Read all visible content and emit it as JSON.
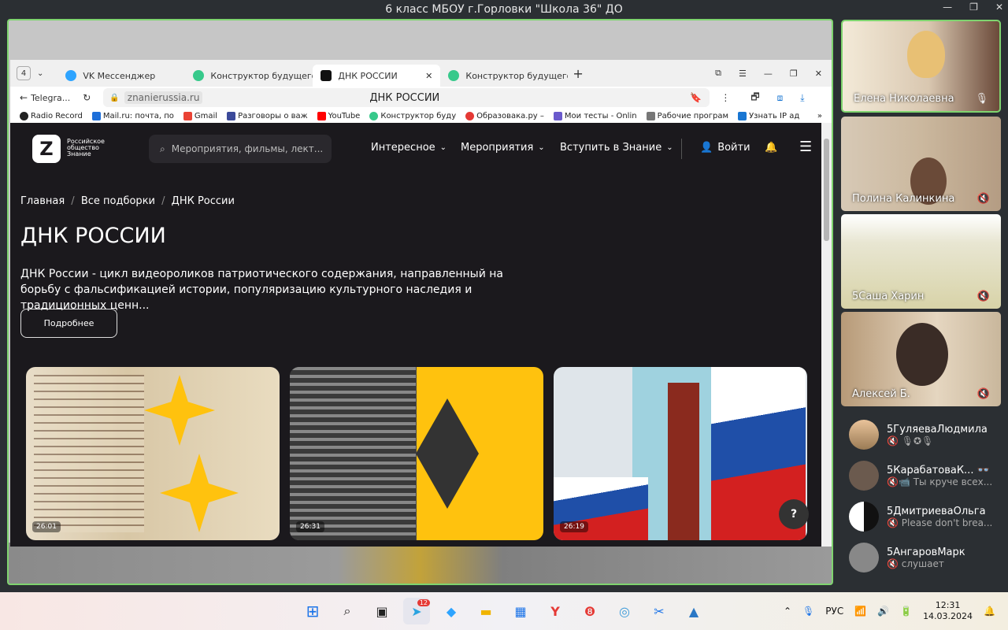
{
  "window": {
    "title": "6 класс МБОУ г.Горловки \"Школа 36\" ДО"
  },
  "browser": {
    "tab_count": "4",
    "tabs": [
      {
        "label": "VK Мессенджер",
        "color": "#2ea4ff"
      },
      {
        "label": "Конструктор будущего",
        "color": "#37c98b"
      },
      {
        "label": "ДНК РОССИИ",
        "color": "#111111"
      },
      {
        "label": "Конструктор будущего",
        "color": "#37c98b"
      }
    ],
    "back_label": "Telegra...",
    "url": "znanierussia.ru",
    "page_title": "ДНК РОССИИ",
    "bookmarks": [
      {
        "label": "Radio Record",
        "color": "#222222"
      },
      {
        "label": "Mail.ru: почта, по",
        "color": "#1e6fd9"
      },
      {
        "label": "Gmail",
        "color": "#ea4335"
      },
      {
        "label": "Разговоры о важ",
        "color": "#3c4a9a"
      },
      {
        "label": "YouTube",
        "color": "#ff0000"
      },
      {
        "label": "Конструктор буду",
        "color": "#37c98b"
      },
      {
        "label": "Образовака.ру –",
        "color": "#e53935"
      },
      {
        "label": "Мои тесты - Onlin",
        "color": "#6a5acd"
      },
      {
        "label": "Рабочие програм",
        "color": "#777777"
      },
      {
        "label": "Узнать IP ад",
        "color": "#1976d2"
      }
    ]
  },
  "site": {
    "logo_text": "Российское общество Знание",
    "search_placeholder": "Мероприятия, фильмы, лект...",
    "nav": [
      "Интересное",
      "Мероприятия",
      "Вступить в Знание"
    ],
    "login": "Войти",
    "breadcrumbs": [
      "Главная",
      "Все подборки",
      "ДНК России"
    ],
    "heading": "ДНК РОССИИ",
    "description": "ДНК России - цикл видеороликов патриотического содержания, направленный на борьбу с фальсификацией истории, популяризацию культурного наследия и традиционных ценн...",
    "more_button": "Подробнее",
    "cards": [
      {
        "duration": "26:01"
      },
      {
        "duration": "26:31"
      },
      {
        "duration": "26:19"
      }
    ]
  },
  "participants": [
    {
      "name": "Елена Николаевна",
      "mic": "on"
    },
    {
      "name": "Полина Калинкина",
      "mic": "off"
    },
    {
      "name": "5Саша Харин",
      "mic": "off"
    },
    {
      "name": "Алексей Б.",
      "mic": "off"
    }
  ],
  "participant_list": [
    {
      "name": "5ГуляеваЛюдмила",
      "status": "🎙✪🎙"
    },
    {
      "name": "5КарабатоваК...",
      "status": "Ты круче всех..."
    },
    {
      "name": "5ДмитриеваОльга",
      "status": "Please don't brea..."
    },
    {
      "name": "5АнгаровМарк",
      "status": "слушает"
    }
  ],
  "taskbar": {
    "telegram_badge": "12",
    "lang": "РУС",
    "time": "12:31",
    "date": "14.03.2024"
  }
}
